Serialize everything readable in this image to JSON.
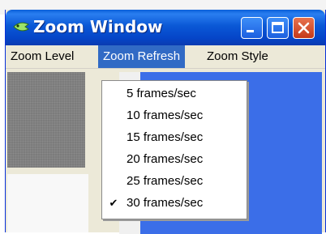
{
  "window": {
    "title": "Zoom Window",
    "controls": [
      "minimize-icon",
      "maximize-icon",
      "close-icon"
    ],
    "titlebar_color": "#0a58d6"
  },
  "menubar": {
    "items": [
      {
        "label": "Zoom Level"
      },
      {
        "label": "Zoom Refresh",
        "active": true
      },
      {
        "label": "Zoom Style"
      }
    ],
    "highlight_color": "#316ac5"
  },
  "zoom_refresh_menu": {
    "items": [
      {
        "label": "5 frames/sec",
        "checked": false
      },
      {
        "label": "10 frames/sec",
        "checked": false
      },
      {
        "label": "15 frames/sec",
        "checked": false
      },
      {
        "label": "20 frames/sec",
        "checked": false
      },
      {
        "label": "25 frames/sec",
        "checked": false
      },
      {
        "label": "30 frames/sec",
        "checked": true
      }
    ],
    "check_glyph": "✔"
  }
}
